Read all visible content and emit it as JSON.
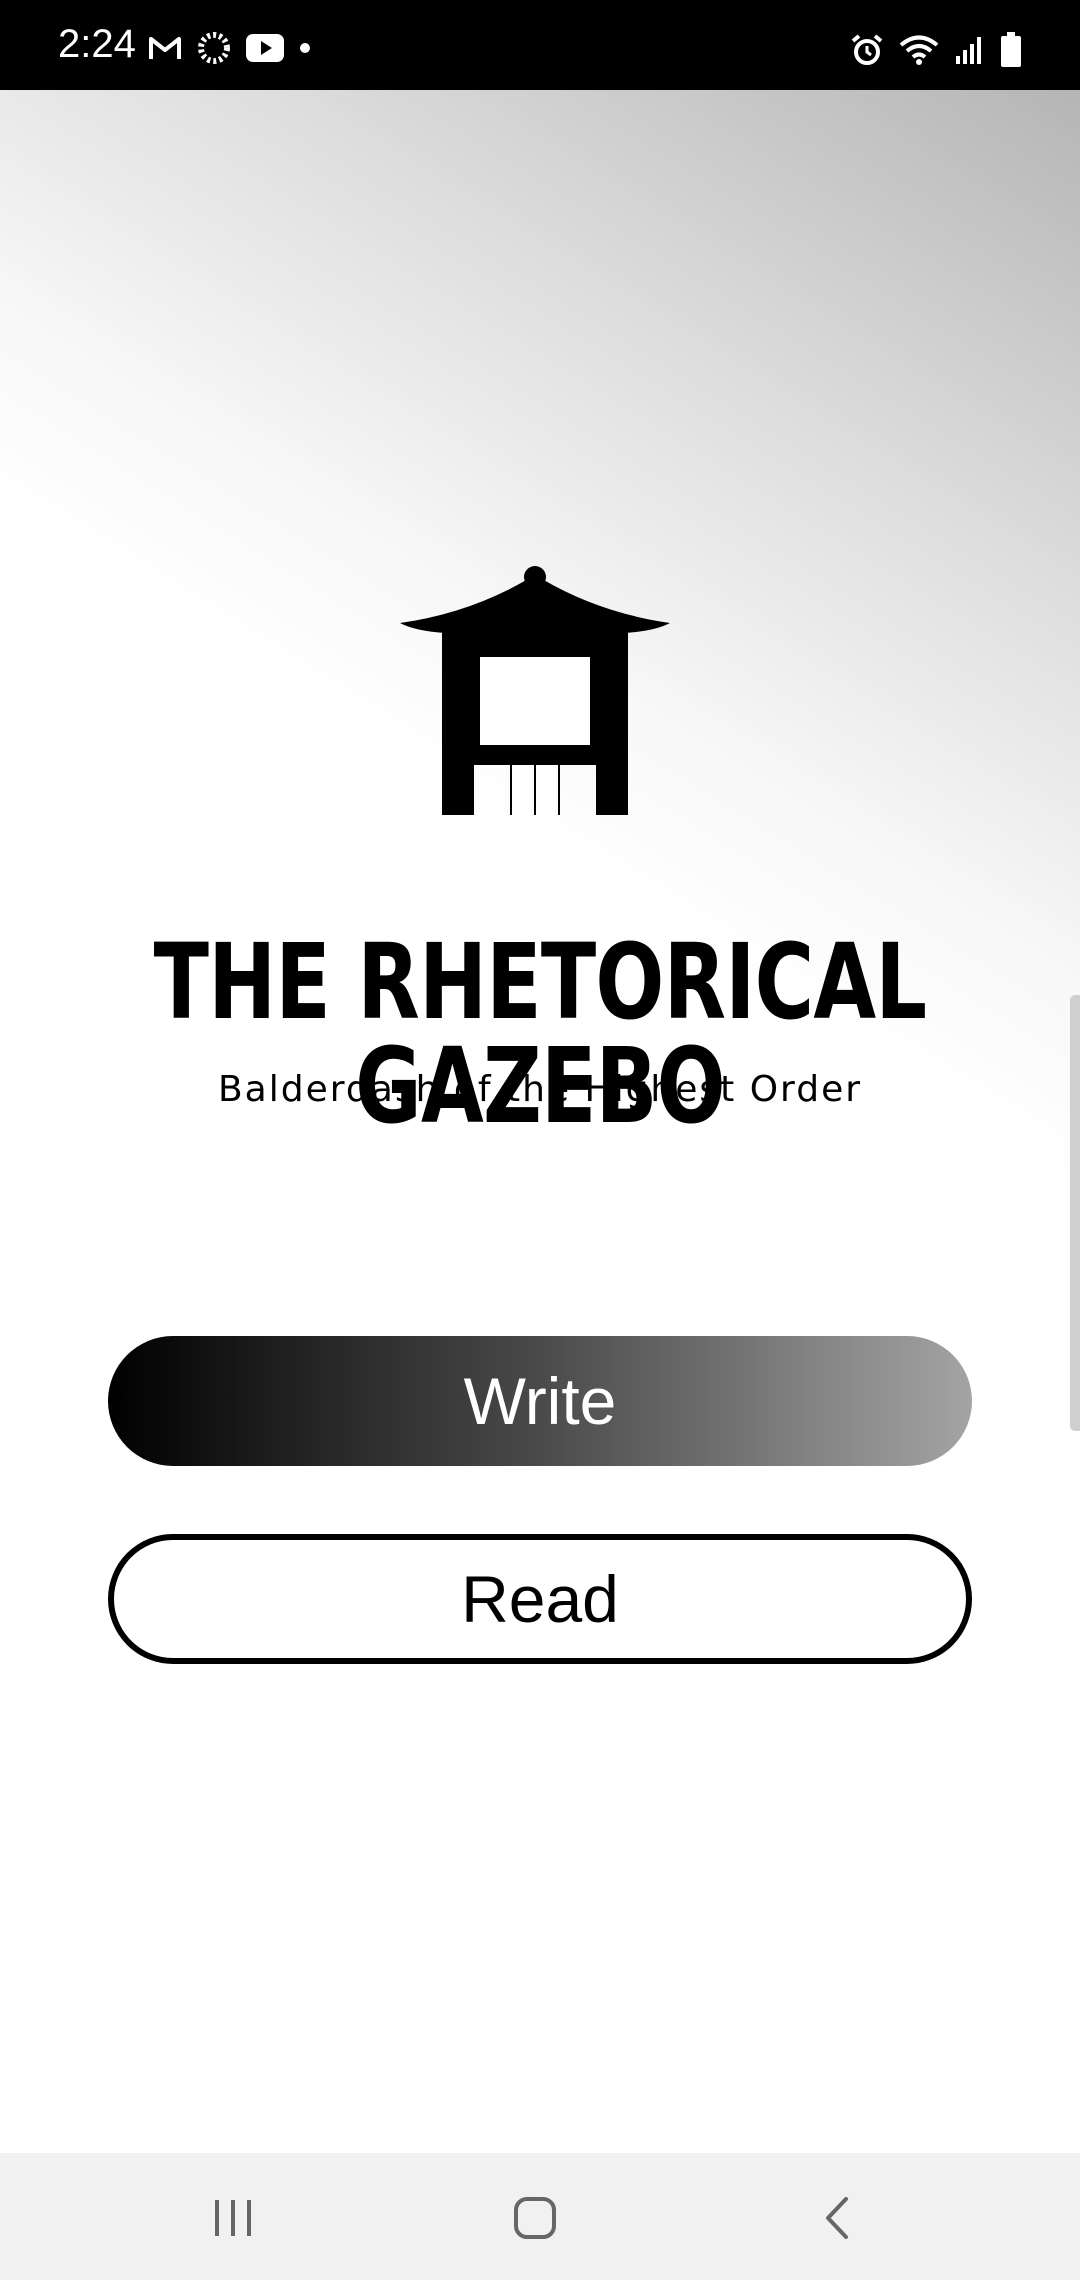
{
  "status_bar": {
    "time": "2:24",
    "left_icons": [
      "gmail-icon",
      "sync-icon",
      "youtube-icon",
      "dot-icon"
    ],
    "right_icons": [
      "alarm-icon",
      "wifi-icon",
      "signal-icon",
      "battery-icon"
    ]
  },
  "app": {
    "logo_icon": "gazebo-icon",
    "title": "THE RHETORICAL GAZEBO",
    "subtitle": "Balderdash of the Highest Order"
  },
  "buttons": {
    "write_label": "Write",
    "read_label": "Read"
  },
  "nav_bar": {
    "icons": [
      "recents-icon",
      "home-icon",
      "back-icon"
    ]
  },
  "colors": {
    "status_bar_bg": "#000000",
    "nav_bar_bg": "#f1f1f1",
    "write_gradient_start": "#000000",
    "write_gradient_end": "#a4a4a4",
    "read_border": "#000000"
  }
}
